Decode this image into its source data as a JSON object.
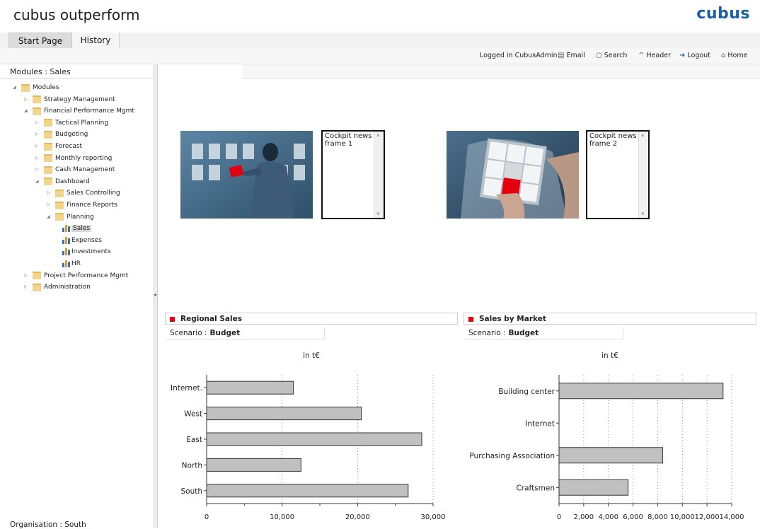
{
  "app": {
    "title": "cubus outperform",
    "logo": "cubus"
  },
  "tabs": [
    {
      "label": "Start Page"
    },
    {
      "label": "History"
    }
  ],
  "toolbar": {
    "logged_in": "Logged in CubusAdmin",
    "email": "Email",
    "search": "Search",
    "header": "Header",
    "logout": "Logout",
    "home": "Home"
  },
  "left": {
    "header": "Modules : Sales",
    "footer": "Organisation : South",
    "tree": [
      {
        "label": "Modules",
        "level": 0,
        "kind": "folder",
        "state": "open"
      },
      {
        "label": "Strategy Management",
        "level": 1,
        "kind": "folder",
        "state": "closed"
      },
      {
        "label": "Financial Performance Mgmt",
        "level": 1,
        "kind": "folder",
        "state": "open"
      },
      {
        "label": "Tactical Planning",
        "level": 2,
        "kind": "folder",
        "state": "closed"
      },
      {
        "label": "Budgeting",
        "level": 2,
        "kind": "folder",
        "state": "closed"
      },
      {
        "label": "Forecast",
        "level": 2,
        "kind": "folder",
        "state": "closed"
      },
      {
        "label": "Monthly reporting",
        "level": 2,
        "kind": "folder",
        "state": "closed"
      },
      {
        "label": "Cash Management",
        "level": 2,
        "kind": "folder",
        "state": "closed"
      },
      {
        "label": "Dashboard",
        "level": 2,
        "kind": "folder",
        "state": "open"
      },
      {
        "label": "Sales Controlling",
        "level": 3,
        "kind": "folder",
        "state": "closed"
      },
      {
        "label": "Finance Reports",
        "level": 3,
        "kind": "folder",
        "state": "closed"
      },
      {
        "label": "Planning",
        "level": 3,
        "kind": "folder",
        "state": "open"
      },
      {
        "label": "Sales",
        "level": 4,
        "kind": "report",
        "selected": true
      },
      {
        "label": "Expenses",
        "level": 4,
        "kind": "report"
      },
      {
        "label": "Investments",
        "level": 4,
        "kind": "report"
      },
      {
        "label": "HR",
        "level": 4,
        "kind": "report"
      },
      {
        "label": "Project Performance Mgmt",
        "level": 1,
        "kind": "folder",
        "state": "closed"
      },
      {
        "label": "Administration",
        "level": 1,
        "kind": "folder",
        "state": "closed"
      }
    ]
  },
  "cockpit": {
    "frame1": "Cockpit news frame 1",
    "frame2": "Cockpit news frame 2"
  },
  "colors": {
    "accent": "#e3000f",
    "bar_fill": "#c0c0c0",
    "logo": "#1d5fa3"
  },
  "chart_data": [
    {
      "type": "bar",
      "orientation": "horizontal",
      "title": "Regional Sales",
      "scenario_label": "Scenario :",
      "scenario": "Budget",
      "subtitle": "in t€",
      "categories": [
        "Internet.",
        "West",
        "East",
        "North",
        "South"
      ],
      "values": [
        11500,
        20500,
        28500,
        12500,
        26700
      ],
      "xlim": [
        0,
        30000
      ],
      "xticks": [
        "0",
        "10,000",
        "20,000",
        "30,000"
      ],
      "tick_values": [
        0,
        10000,
        20000,
        30000
      ],
      "grid": "vertical-dotted"
    },
    {
      "type": "bar",
      "orientation": "horizontal",
      "title": "Sales by Market",
      "scenario_label": "Scenario :",
      "scenario": "Budget",
      "subtitle": "in t€",
      "categories": [
        "Building center",
        "Internet",
        "Purchasing Association",
        "Craftsmen"
      ],
      "values": [
        13300,
        0,
        8400,
        5600
      ],
      "xlim": [
        0,
        14000
      ],
      "xticks": [
        "0",
        "2,000",
        "4,000",
        "6,000",
        "8,000",
        "10,000",
        "12,000",
        "14,000"
      ],
      "tick_values": [
        0,
        2000,
        4000,
        6000,
        8000,
        10000,
        12000,
        14000
      ],
      "grid": "vertical-dotted"
    }
  ]
}
